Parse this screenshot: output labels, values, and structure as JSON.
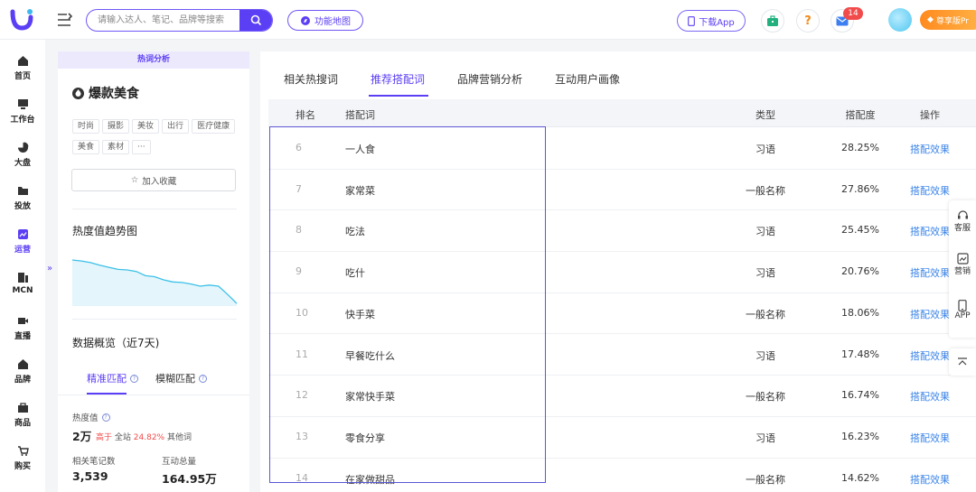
{
  "topbar": {
    "search_placeholder": "请输入达人、笔记、品牌等搜索",
    "map_button": "功能地图",
    "download_button": "下载App",
    "message_badge": "14",
    "vip_label": "尊享版Pr"
  },
  "nav": [
    {
      "label": "首页",
      "icon": "home-icon"
    },
    {
      "label": "工作台",
      "icon": "workbench-icon"
    },
    {
      "label": "大盘",
      "icon": "pie-chart-icon"
    },
    {
      "label": "投放",
      "icon": "folder-icon"
    },
    {
      "label": "运营",
      "icon": "trend-icon",
      "active": true
    },
    {
      "label": "MCN",
      "icon": "mcn-icon"
    },
    {
      "label": "直播",
      "icon": "video-icon"
    },
    {
      "label": "品牌",
      "icon": "brand-icon"
    },
    {
      "label": "商品",
      "icon": "bag-icon"
    },
    {
      "label": "购买",
      "icon": "cart-icon"
    }
  ],
  "panel": {
    "tag": "热词分析",
    "keyword": "爆款美食",
    "tags": [
      "时尚",
      "摄影",
      "美妆",
      "出行",
      "医疗健康",
      "美食",
      "素材",
      "···"
    ],
    "fav_button": "加入收藏",
    "trend_title": "热度值趋势图",
    "trend_values": [
      0.88,
      0.86,
      0.83,
      0.78,
      0.74,
      0.7,
      0.69,
      0.66,
      0.58,
      0.56,
      0.5,
      0.46,
      0.45,
      0.42,
      0.38,
      0.4,
      0.38,
      0.22,
      0.05
    ],
    "overview_title": "数据概览（近7天)",
    "match_tabs": [
      "精准匹配",
      "模糊匹配"
    ],
    "heat_label": "热度值",
    "heat_value": "2万",
    "heat_compare_prefix": "高于",
    "heat_compare_mid": "全站",
    "heat_compare_pct": "24.82%",
    "heat_compare_suffix": "其他词",
    "notes_label": "相关笔记数",
    "notes_value": "3,539",
    "interact_label": "互动总量",
    "interact_value": "164.95万"
  },
  "main": {
    "tabs": [
      "相关热搜词",
      "推荐搭配词",
      "品牌营销分析",
      "互动用户画像"
    ],
    "active_tab": 1,
    "columns": [
      "排名",
      "搭配词",
      "类型",
      "搭配度",
      "操作"
    ],
    "rows": [
      {
        "rank": "6",
        "word": "一人食",
        "type": "习语",
        "pct": "28.25%",
        "action": "搭配效果"
      },
      {
        "rank": "7",
        "word": "家常菜",
        "type": "一般名称",
        "pct": "27.86%",
        "action": "搭配效果"
      },
      {
        "rank": "8",
        "word": "吃法",
        "type": "习语",
        "pct": "25.45%",
        "action": "搭配效果"
      },
      {
        "rank": "9",
        "word": "吃什",
        "type": "习语",
        "pct": "20.76%",
        "action": "搭配效果"
      },
      {
        "rank": "10",
        "word": "快手菜",
        "type": "一般名称",
        "pct": "18.06%",
        "action": "搭配效果"
      },
      {
        "rank": "11",
        "word": "早餐吃什么",
        "type": "习语",
        "pct": "17.48%",
        "action": "搭配效果"
      },
      {
        "rank": "12",
        "word": "家常快手菜",
        "type": "一般名称",
        "pct": "16.74%",
        "action": "搭配效果"
      },
      {
        "rank": "13",
        "word": "零食分享",
        "type": "习语",
        "pct": "16.23%",
        "action": "搭配效果"
      },
      {
        "rank": "14",
        "word": "在家做甜品",
        "type": "一般名称",
        "pct": "14.62%",
        "action": "搭配效果"
      }
    ]
  },
  "float": [
    {
      "label": "客服",
      "icon": "headset-icon"
    },
    {
      "label": "营销",
      "icon": "marketing-icon"
    },
    {
      "label": "APP",
      "icon": "phone-icon"
    }
  ]
}
